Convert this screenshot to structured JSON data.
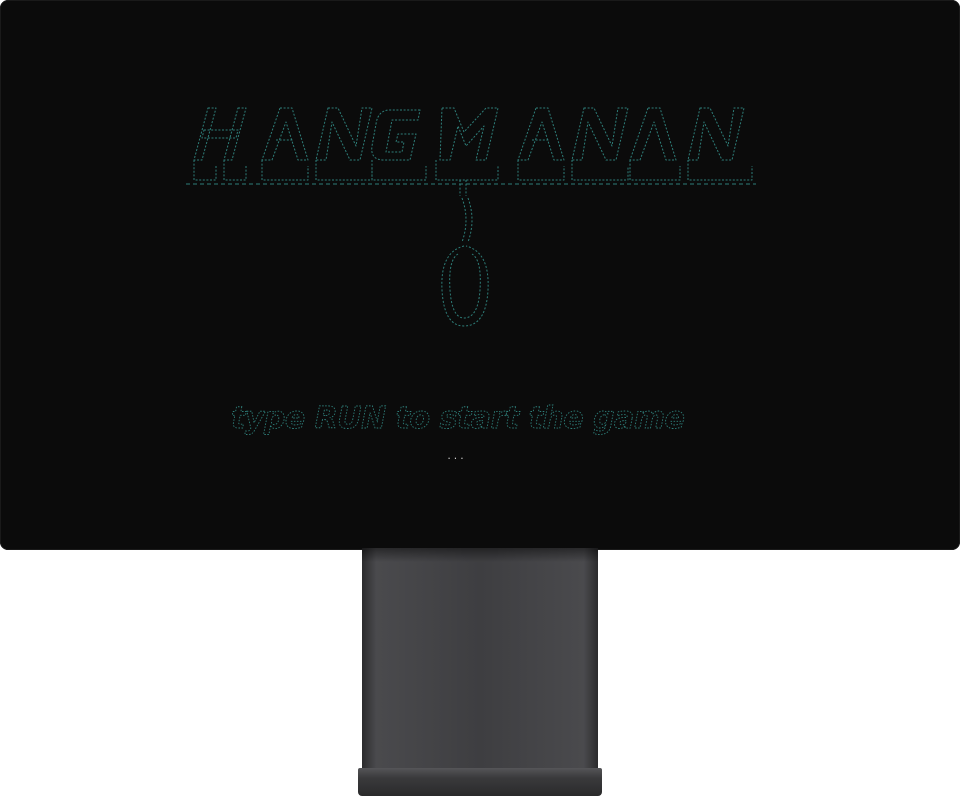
{
  "game": {
    "title_art_text": "HANGMAN",
    "prompt": "type RUN to start the game",
    "cursor": "..."
  },
  "colors": {
    "screen_bg": "#0b0b0b",
    "ascii_teal": "#2e7e79",
    "stand_metal": "#3e3e41"
  },
  "icons": {
    "noose": "noose-ascii-art"
  }
}
